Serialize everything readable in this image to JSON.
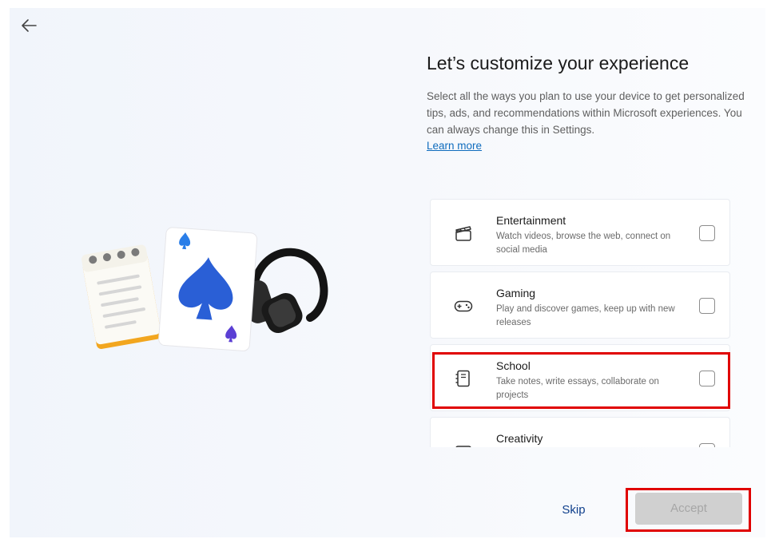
{
  "header": {
    "title": "Let’s customize your experience",
    "description": "Select all the ways you plan to use your device to get personalized tips, ads, and recommendations within Microsoft experiences. You can always change this in Settings.",
    "learn_more": "Learn more"
  },
  "back": {
    "icon": "arrow-left-icon"
  },
  "options": [
    {
      "title": "Entertainment",
      "subtitle": "Watch videos, browse the web, connect on social media",
      "icon": "clapperboard-icon",
      "checked": false
    },
    {
      "title": "Gaming",
      "subtitle": "Play and discover games, keep up with new releases",
      "icon": "gamepad-icon",
      "checked": false
    },
    {
      "title": "School",
      "subtitle": "Take notes, write essays, collaborate on projects",
      "icon": "notebook-icon",
      "checked": false,
      "highlighted": true
    },
    {
      "title": "Creativity",
      "subtitle": "",
      "icon": "pen-icon",
      "checked": false
    }
  ],
  "footer": {
    "skip": "Skip",
    "accept": "Accept",
    "accept_enabled": false
  },
  "colors": {
    "accent": "#0f6cbd",
    "highlight": "#e00000",
    "spade": "#2a5fd6",
    "notepad_edge": "#f2a61f"
  }
}
